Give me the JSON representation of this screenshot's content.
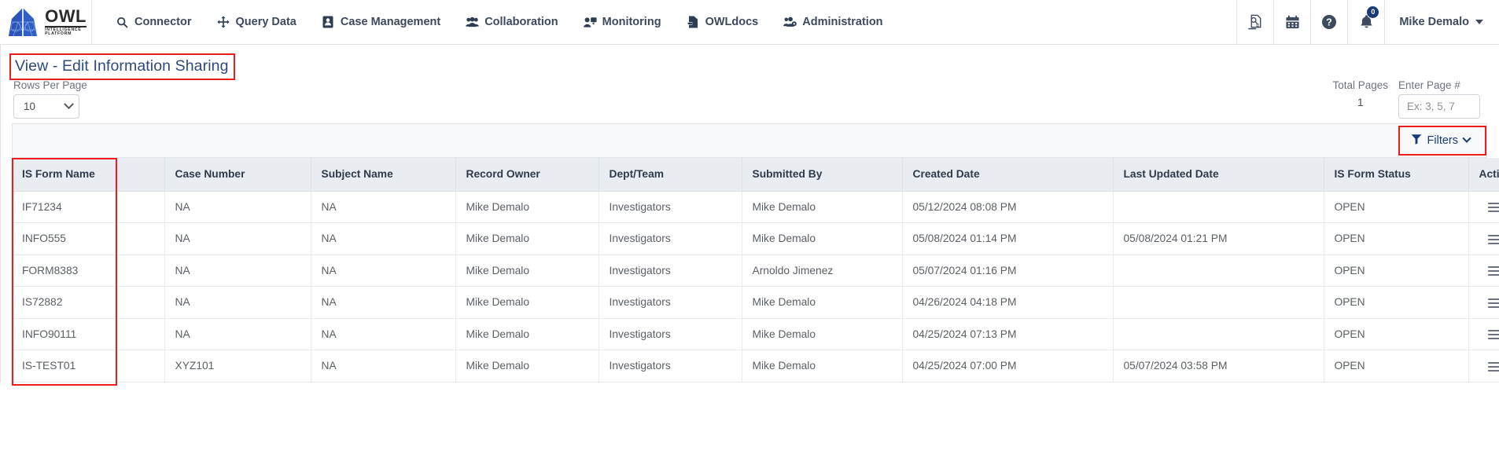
{
  "navbar": {
    "brand": {
      "name": "OWL",
      "tagline_line1": "INTELLIGENCE",
      "tagline_line2": "PLATFORM"
    },
    "items": [
      {
        "label": "Connector",
        "icon": "search-icon"
      },
      {
        "label": "Query Data",
        "icon": "move-arrows-icon"
      },
      {
        "label": "Case Management",
        "icon": "id-card-icon"
      },
      {
        "label": "Collaboration",
        "icon": "users-icon"
      },
      {
        "label": "Monitoring",
        "icon": "user-screen-icon"
      },
      {
        "label": "OWLdocs",
        "icon": "file-export-icon"
      },
      {
        "label": "Administration",
        "icon": "user-cog-icon"
      }
    ],
    "tools": [
      {
        "icon": "report-search-icon"
      },
      {
        "icon": "calendar-icon"
      },
      {
        "icon": "help-circle-icon"
      },
      {
        "icon": "bell-icon",
        "badge": "0"
      }
    ],
    "user": {
      "name": "Mike Demalo",
      "caret": "chevron-down-icon"
    }
  },
  "page": {
    "title": "View - Edit Information Sharing",
    "rows_per_page": {
      "label": "Rows Per Page",
      "value": "10"
    },
    "total_pages": {
      "label": "Total Pages",
      "value": "1"
    },
    "enter_page": {
      "label": "Enter Page #",
      "placeholder": "Ex: 3, 5, 7",
      "value": ""
    },
    "filters_button": {
      "label": "Filters",
      "icon": "funnel-icon",
      "caret": "chevron-down-icon"
    }
  },
  "table": {
    "columns": [
      "IS Form Name",
      "Case Number",
      "Subject Name",
      "Record Owner",
      "Dept/Team",
      "Submitted By",
      "Created Date",
      "Last Updated Date",
      "IS Form Status",
      "Action"
    ],
    "rows": [
      {
        "is_form_name": "IF71234",
        "case_number": "NA",
        "subject_name": "NA",
        "record_owner": "Mike Demalo",
        "dept_team": "Investigators",
        "submitted_by": "Mike Demalo",
        "created_date": "05/12/2024 08:08 PM",
        "last_updated_date": "",
        "is_form_status": "OPEN",
        "action": "row-menu-icon"
      },
      {
        "is_form_name": "INFO555",
        "case_number": "NA",
        "subject_name": "NA",
        "record_owner": "Mike Demalo",
        "dept_team": "Investigators",
        "submitted_by": "Mike Demalo",
        "created_date": "05/08/2024 01:14 PM",
        "last_updated_date": "05/08/2024 01:21 PM",
        "is_form_status": "OPEN",
        "action": "row-menu-icon"
      },
      {
        "is_form_name": "FORM8383",
        "case_number": "NA",
        "subject_name": "NA",
        "record_owner": "Mike Demalo",
        "dept_team": "Investigators",
        "submitted_by": "Arnoldo Jimenez",
        "created_date": "05/07/2024 01:16 PM",
        "last_updated_date": "",
        "is_form_status": "OPEN",
        "action": "row-menu-icon"
      },
      {
        "is_form_name": "IS72882",
        "case_number": "NA",
        "subject_name": "NA",
        "record_owner": "Mike Demalo",
        "dept_team": "Investigators",
        "submitted_by": "Mike Demalo",
        "created_date": "04/26/2024 04:18 PM",
        "last_updated_date": "",
        "is_form_status": "OPEN",
        "action": "row-menu-icon"
      },
      {
        "is_form_name": "INFO90111",
        "case_number": "NA",
        "subject_name": "NA",
        "record_owner": "Mike Demalo",
        "dept_team": "Investigators",
        "submitted_by": "Mike Demalo",
        "created_date": "04/25/2024 07:13 PM",
        "last_updated_date": "",
        "is_form_status": "OPEN",
        "action": "row-menu-icon"
      },
      {
        "is_form_name": "IS-TEST01",
        "case_number": "XYZ101",
        "subject_name": "NA",
        "record_owner": "Mike Demalo",
        "dept_team": "Investigators",
        "submitted_by": "Mike Demalo",
        "created_date": "04/25/2024 07:00 PM",
        "last_updated_date": "05/07/2024 03:58 PM",
        "is_form_status": "OPEN",
        "action": "row-menu-icon"
      }
    ]
  },
  "annotations": {
    "highlight_color": "#ef1c1c",
    "boxes": [
      "page-title",
      "filters-button",
      "is-form-name-column"
    ]
  },
  "colors": {
    "brand_blue": "#1b3a78",
    "title_blue": "#2e4a78",
    "header_bg": "#e9edf1",
    "annotation_red": "#ef1c1c"
  }
}
